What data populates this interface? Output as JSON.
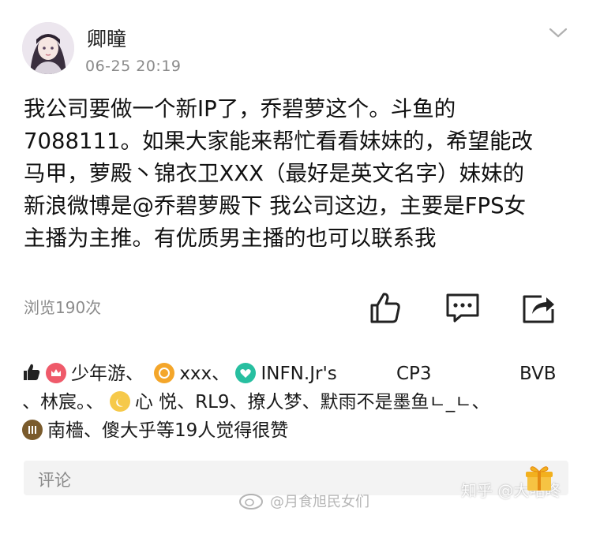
{
  "header": {
    "username": "卿瞳",
    "timestamp": "06-25 20:19",
    "avatar_icon": "avatar-girl-icon",
    "menu_icon": "chevron-down-icon"
  },
  "post": {
    "lines": [
      "我公司要做一个新IP了，乔碧萝这个。斗鱼的",
      "7088111。如果大家能来帮忙看看妹妹的，希望能改",
      "马甲，萝殿丶锦衣卫XXX（最好是英文名字）妹妹的",
      "新浪微博是@乔碧萝殿下  我公司这边，主要是FPS女",
      "主播为主推。有优质男主播的也可以联系我"
    ]
  },
  "stats": {
    "views": "浏览190次"
  },
  "actions": {
    "like_icon": "thumbs-up-icon",
    "comment_icon": "comment-icon",
    "share_icon": "share-icon"
  },
  "likes": {
    "row1": {
      "user1": "少年游、",
      "user2": "xxx、",
      "user3": "INFN.Jr's",
      "user4": "CP3",
      "user5": "BVB"
    },
    "row2": {
      "prefix": "、林宸。、",
      "user6": "心 悦、RL9、撩人梦、默雨不是墨鱼ㄴ_ㄴ、"
    },
    "row3": {
      "user7": "南檣、傻大乎等19人觉得很赞"
    },
    "badge_colors": [
      "#ef5a6a",
      "#f4a62a",
      "#27bfa0",
      "#f6c94a",
      "#7a5b2c"
    ]
  },
  "comment": {
    "placeholder": "评论"
  },
  "watermarks": {
    "weibo": "@月食旭民女们",
    "zhihu": "知乎 @大咕咚"
  },
  "colors": {
    "text": "#111111",
    "muted": "#8a8a8a",
    "comment_bg": "#f3f3f3"
  }
}
